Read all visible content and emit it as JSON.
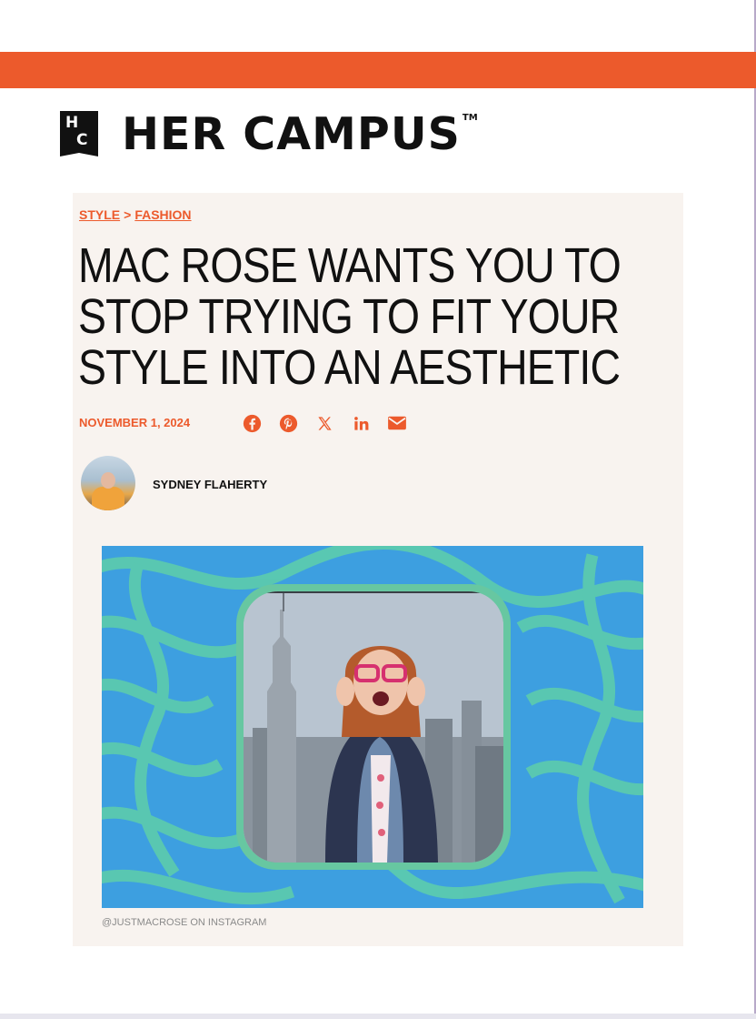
{
  "brand": {
    "name": "HER CAMPUS",
    "trademark": "TM",
    "stripe_color": "#ec5a2c",
    "accent_color": "#ec5a2c"
  },
  "breadcrumb": {
    "section": "STYLE",
    "separator": ">",
    "subsection": "FASHION"
  },
  "article": {
    "headline_lines": [
      "MAC ROSE WANTS YOU TO",
      "STOP TRYING TO FIT YOUR",
      "STYLE INTO AN AESTHETIC"
    ],
    "date": "NOVEMBER 1, 2024",
    "author": "SYDNEY FLAHERTY",
    "image_caption": "@JUSTMACROSE ON INSTAGRAM"
  },
  "share_icons": [
    "facebook-icon",
    "pinterest-icon",
    "x-icon",
    "linkedin-icon",
    "email-icon"
  ]
}
